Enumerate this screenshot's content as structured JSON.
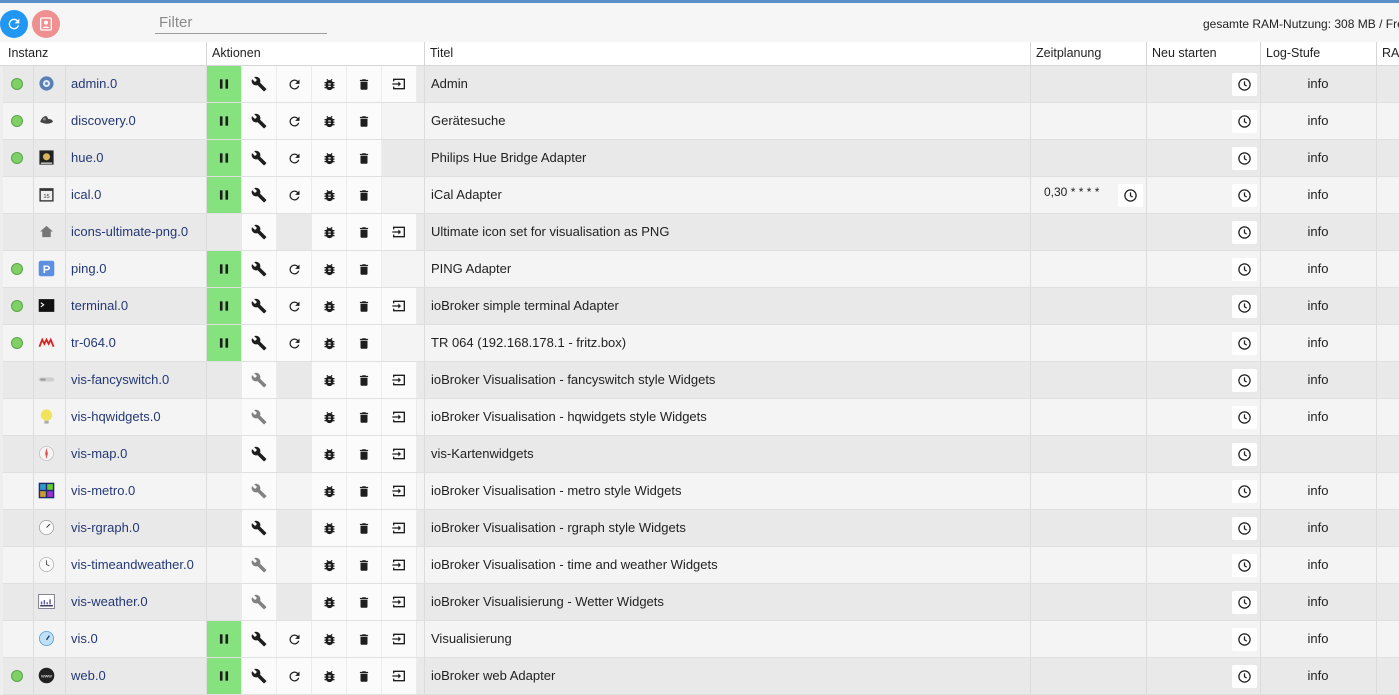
{
  "toolbar": {
    "refresh_icon": "refresh-icon",
    "user_icon": "user-icon",
    "filter_placeholder": "Filter",
    "ram_text": "gesamte RAM-Nutzung: 308 MB / Fre"
  },
  "columns": {
    "instanz": "Instanz",
    "aktionen": "Aktionen",
    "titel": "Titel",
    "zeitplanung": "Zeitplanung",
    "neu_starten": "Neu starten",
    "log_stufe": "Log-Stufe",
    "ram": "RAI"
  },
  "colors": {
    "status_green": "#7fd067",
    "pause_green": "#86e27f",
    "link_blue": "#243876",
    "refresh_blue": "#2196f3",
    "user_pink": "#ef8f8f"
  },
  "instances": [
    {
      "name": "admin.0",
      "title": "Admin",
      "status": true,
      "pause": true,
      "wrench": true,
      "reload": true,
      "bug": true,
      "trash": true,
      "link": true,
      "schedule": "",
      "log": "info",
      "icon": "admin-gear-icon"
    },
    {
      "name": "discovery.0",
      "title": "Gerätesuche",
      "status": true,
      "pause": true,
      "wrench": true,
      "reload": true,
      "bug": true,
      "trash": true,
      "link": false,
      "schedule": "",
      "log": "info",
      "icon": "discovery-icon"
    },
    {
      "name": "hue.0",
      "title": "Philips Hue Bridge Adapter",
      "status": true,
      "pause": true,
      "wrench": true,
      "reload": true,
      "bug": true,
      "trash": true,
      "link": false,
      "schedule": "",
      "log": "info",
      "icon": "hue-icon"
    },
    {
      "name": "ical.0",
      "title": "iCal Adapter",
      "status": false,
      "pause": true,
      "wrench": true,
      "reload": true,
      "bug": true,
      "trash": true,
      "link": false,
      "schedule": "0,30 * * * *",
      "log": "info",
      "icon": "calendar-icon"
    },
    {
      "name": "icons-ultimate-png.0",
      "title": "Ultimate icon set for visualisation as PNG",
      "status": false,
      "pause": false,
      "wrench": true,
      "reload": false,
      "bug": true,
      "trash": true,
      "link": true,
      "schedule": "",
      "log": "info",
      "icon": "house-icon"
    },
    {
      "name": "ping.0",
      "title": "PING Adapter",
      "status": true,
      "pause": true,
      "wrench": true,
      "reload": true,
      "bug": true,
      "trash": true,
      "link": false,
      "schedule": "",
      "log": "info",
      "icon": "ping-icon"
    },
    {
      "name": "terminal.0",
      "title": "ioBroker simple terminal Adapter",
      "status": true,
      "pause": true,
      "wrench": true,
      "reload": true,
      "bug": true,
      "trash": true,
      "link": true,
      "schedule": "",
      "log": "info",
      "icon": "terminal-icon"
    },
    {
      "name": "tr-064.0",
      "title": "TR 064 (192.168.178.1 - fritz.box)",
      "status": true,
      "pause": true,
      "wrench": true,
      "reload": true,
      "bug": true,
      "trash": true,
      "link": false,
      "schedule": "",
      "log": "info",
      "icon": "avm-icon"
    },
    {
      "name": "vis-fancyswitch.0",
      "title": "ioBroker Visualisation - fancyswitch style Widgets",
      "status": false,
      "pause": false,
      "wrench": "dim",
      "reload": false,
      "bug": true,
      "trash": true,
      "link": true,
      "schedule": "",
      "log": "info",
      "icon": "switch-icon"
    },
    {
      "name": "vis-hqwidgets.0",
      "title": "ioBroker Visualisation - hqwidgets style Widgets",
      "status": false,
      "pause": false,
      "wrench": "dim",
      "reload": false,
      "bug": true,
      "trash": true,
      "link": true,
      "schedule": "",
      "log": "info",
      "icon": "bulb-icon"
    },
    {
      "name": "vis-map.0",
      "title": "vis-Kartenwidgets",
      "status": false,
      "pause": false,
      "wrench": true,
      "reload": false,
      "bug": true,
      "trash": true,
      "link": true,
      "schedule": "",
      "log": "",
      "icon": "compass-icon"
    },
    {
      "name": "vis-metro.0",
      "title": "ioBroker Visualisation - metro style Widgets",
      "status": false,
      "pause": false,
      "wrench": "dim",
      "reload": false,
      "bug": true,
      "trash": true,
      "link": true,
      "schedule": "",
      "log": "info",
      "icon": "metro-icon"
    },
    {
      "name": "vis-rgraph.0",
      "title": "ioBroker Visualisation - rgraph style Widgets",
      "status": false,
      "pause": false,
      "wrench": true,
      "reload": false,
      "bug": true,
      "trash": true,
      "link": true,
      "schedule": "",
      "log": "info",
      "icon": "gauge-icon"
    },
    {
      "name": "vis-timeandweather.0",
      "title": "ioBroker Visualisation - time and weather Widgets",
      "status": false,
      "pause": false,
      "wrench": "dim",
      "reload": false,
      "bug": true,
      "trash": true,
      "link": true,
      "schedule": "",
      "log": "info",
      "icon": "clock-face-icon"
    },
    {
      "name": "vis-weather.0",
      "title": "ioBroker Visualisierung - Wetter Widgets",
      "status": false,
      "pause": false,
      "wrench": "dim",
      "reload": false,
      "bug": true,
      "trash": true,
      "link": true,
      "schedule": "",
      "log": "info",
      "icon": "weather-chart-icon"
    },
    {
      "name": "vis.0",
      "title": "Visualisierung",
      "status": false,
      "pause": true,
      "wrench": true,
      "reload": true,
      "bug": true,
      "trash": true,
      "link": true,
      "schedule": "",
      "log": "info",
      "icon": "vis-gauge-icon"
    },
    {
      "name": "web.0",
      "title": "ioBroker web Adapter",
      "status": true,
      "pause": true,
      "wrench": true,
      "reload": true,
      "bug": true,
      "trash": true,
      "link": true,
      "schedule": "",
      "log": "info",
      "icon": "www-icon"
    }
  ]
}
